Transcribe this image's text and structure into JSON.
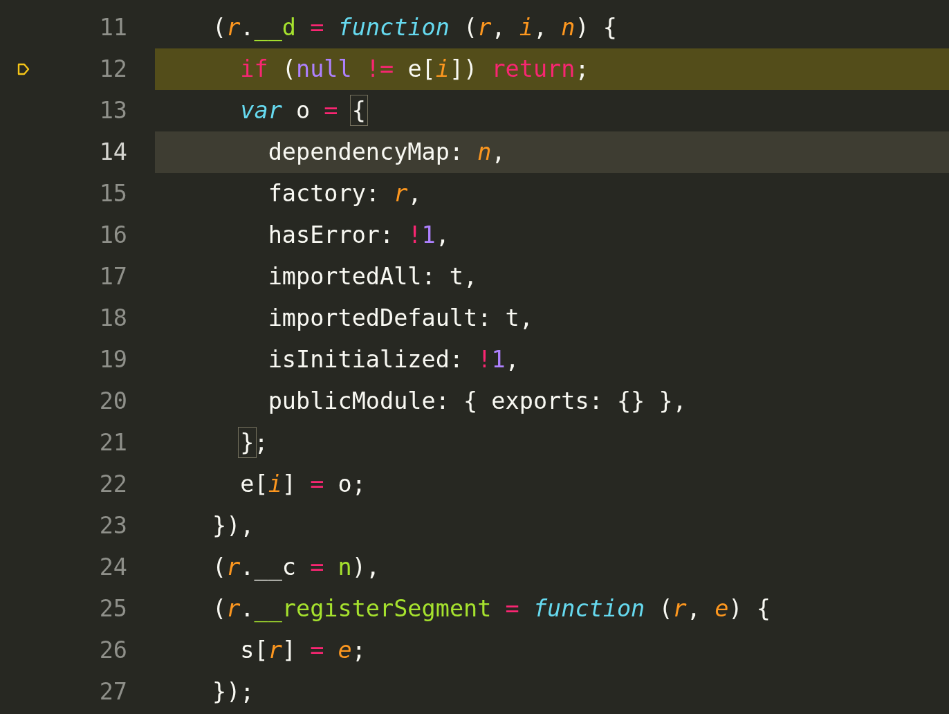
{
  "editor": {
    "lines": [
      {
        "number": "11",
        "selected": false,
        "highlighted": false,
        "paused": false,
        "tokens": [
          {
            "kind": "plain",
            "text": "("
          },
          {
            "kind": "param",
            "text": "r"
          },
          {
            "kind": "plain",
            "text": "."
          },
          {
            "kind": "property",
            "text": "__d"
          },
          {
            "kind": "operator",
            "text": " = "
          },
          {
            "kind": "storage",
            "text": "function"
          },
          {
            "kind": "plain",
            "text": " ("
          },
          {
            "kind": "param",
            "text": "r"
          },
          {
            "kind": "plain",
            "text": ", "
          },
          {
            "kind": "param",
            "text": "i"
          },
          {
            "kind": "plain",
            "text": ", "
          },
          {
            "kind": "param",
            "text": "n"
          },
          {
            "kind": "plain",
            "text": ") {"
          }
        ]
      },
      {
        "number": "12",
        "selected": false,
        "highlighted": true,
        "paused": true,
        "tokens": [
          {
            "kind": "keyword",
            "text": "  if"
          },
          {
            "kind": "plain",
            "text": " ("
          },
          {
            "kind": "constant",
            "text": "null"
          },
          {
            "kind": "operator",
            "text": " != "
          },
          {
            "kind": "plain",
            "text": "e["
          },
          {
            "kind": "param",
            "text": "i"
          },
          {
            "kind": "plain",
            "text": "]) "
          },
          {
            "kind": "keyword",
            "text": "return"
          },
          {
            "kind": "plain",
            "text": ";"
          }
        ]
      },
      {
        "number": "13",
        "selected": false,
        "highlighted": false,
        "paused": false,
        "tokens": [
          {
            "kind": "storage",
            "text": "  var"
          },
          {
            "kind": "plain",
            "text": " o "
          },
          {
            "kind": "operator",
            "text": "= "
          },
          {
            "kind": "bracket",
            "text": "{"
          }
        ]
      },
      {
        "number": "14",
        "selected": true,
        "highlighted": false,
        "paused": false,
        "tokens": [
          {
            "kind": "plain",
            "text": "    dependencyMap: "
          },
          {
            "kind": "param",
            "text": "n"
          },
          {
            "kind": "plain",
            "text": ","
          }
        ]
      },
      {
        "number": "15",
        "selected": false,
        "highlighted": false,
        "paused": false,
        "tokens": [
          {
            "kind": "plain",
            "text": "    factory: "
          },
          {
            "kind": "param",
            "text": "r"
          },
          {
            "kind": "plain",
            "text": ","
          }
        ]
      },
      {
        "number": "16",
        "selected": false,
        "highlighted": false,
        "paused": false,
        "tokens": [
          {
            "kind": "plain",
            "text": "    hasError: "
          },
          {
            "kind": "operator",
            "text": "!"
          },
          {
            "kind": "constant",
            "text": "1"
          },
          {
            "kind": "plain",
            "text": ","
          }
        ]
      },
      {
        "number": "17",
        "selected": false,
        "highlighted": false,
        "paused": false,
        "tokens": [
          {
            "kind": "plain",
            "text": "    importedAll: t,"
          }
        ]
      },
      {
        "number": "18",
        "selected": false,
        "highlighted": false,
        "paused": false,
        "tokens": [
          {
            "kind": "plain",
            "text": "    importedDefault: t,"
          }
        ]
      },
      {
        "number": "19",
        "selected": false,
        "highlighted": false,
        "paused": false,
        "tokens": [
          {
            "kind": "plain",
            "text": "    isInitialized: "
          },
          {
            "kind": "operator",
            "text": "!"
          },
          {
            "kind": "constant",
            "text": "1"
          },
          {
            "kind": "plain",
            "text": ","
          }
        ]
      },
      {
        "number": "20",
        "selected": false,
        "highlighted": false,
        "paused": false,
        "tokens": [
          {
            "kind": "plain",
            "text": "    publicModule: { exports: {} },"
          }
        ]
      },
      {
        "number": "21",
        "selected": false,
        "highlighted": false,
        "paused": false,
        "tokens": [
          {
            "kind": "bracket",
            "text": "  }"
          },
          {
            "kind": "plain",
            "text": ";"
          }
        ]
      },
      {
        "number": "22",
        "selected": false,
        "highlighted": false,
        "paused": false,
        "tokens": [
          {
            "kind": "plain",
            "text": "  e["
          },
          {
            "kind": "param",
            "text": "i"
          },
          {
            "kind": "plain",
            "text": "] "
          },
          {
            "kind": "operator",
            "text": "="
          },
          {
            "kind": "plain",
            "text": " o;"
          }
        ]
      },
      {
        "number": "23",
        "selected": false,
        "highlighted": false,
        "paused": false,
        "tokens": [
          {
            "kind": "plain",
            "text": "}),"
          }
        ]
      },
      {
        "number": "24",
        "selected": false,
        "highlighted": false,
        "paused": false,
        "tokens": [
          {
            "kind": "plain",
            "text": "("
          },
          {
            "kind": "param",
            "text": "r"
          },
          {
            "kind": "plain",
            "text": ".__c"
          },
          {
            "kind": "operator",
            "text": " = "
          },
          {
            "kind": "property",
            "text": "n"
          },
          {
            "kind": "plain",
            "text": "),"
          }
        ]
      },
      {
        "number": "25",
        "selected": false,
        "highlighted": false,
        "paused": false,
        "tokens": [
          {
            "kind": "plain",
            "text": "("
          },
          {
            "kind": "param",
            "text": "r"
          },
          {
            "kind": "plain",
            "text": "."
          },
          {
            "kind": "property",
            "text": "__registerSegment"
          },
          {
            "kind": "operator",
            "text": " = "
          },
          {
            "kind": "storage",
            "text": "function"
          },
          {
            "kind": "plain",
            "text": " ("
          },
          {
            "kind": "param",
            "text": "r"
          },
          {
            "kind": "plain",
            "text": ", "
          },
          {
            "kind": "param",
            "text": "e"
          },
          {
            "kind": "plain",
            "text": ") {"
          }
        ]
      },
      {
        "number": "26",
        "selected": false,
        "highlighted": false,
        "paused": false,
        "tokens": [
          {
            "kind": "plain",
            "text": "  s["
          },
          {
            "kind": "param",
            "text": "r"
          },
          {
            "kind": "plain",
            "text": "] "
          },
          {
            "kind": "operator",
            "text": "= "
          },
          {
            "kind": "param",
            "text": "e"
          },
          {
            "kind": "plain",
            "text": ";"
          }
        ]
      },
      {
        "number": "27",
        "selected": false,
        "highlighted": false,
        "paused": false,
        "tokens": [
          {
            "kind": "plain",
            "text": "});"
          }
        ]
      }
    ]
  }
}
